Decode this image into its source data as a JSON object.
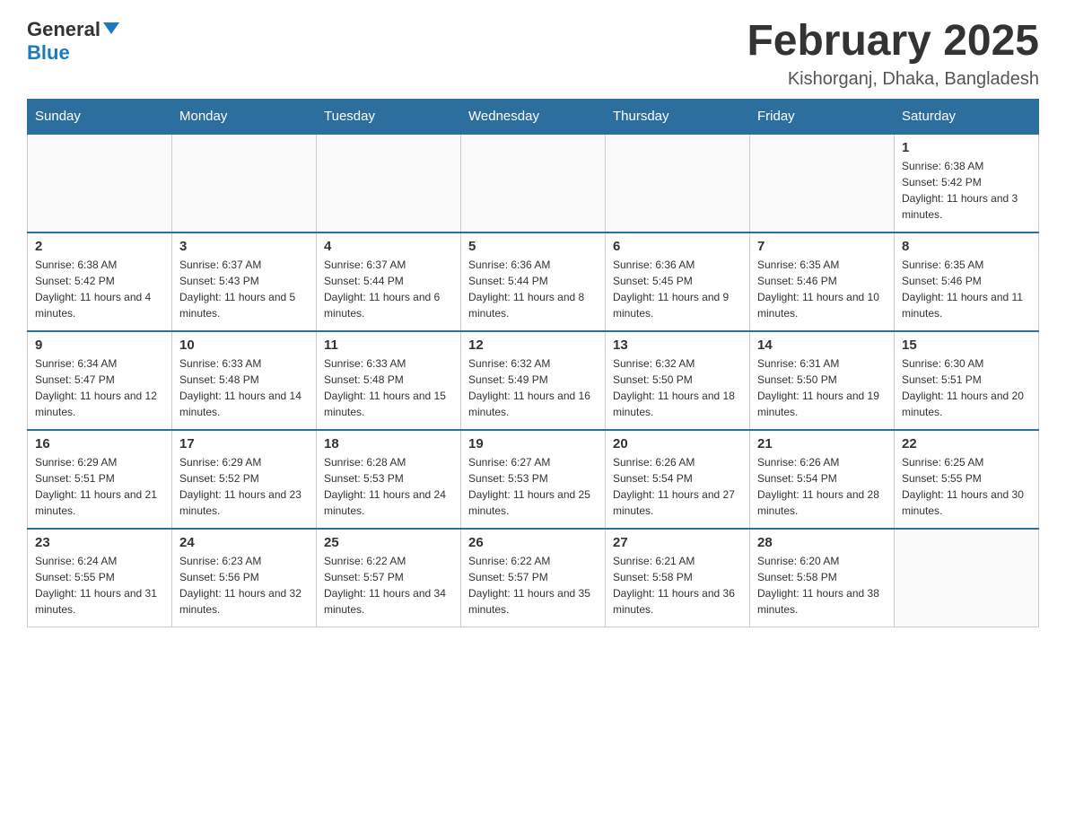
{
  "header": {
    "logo": {
      "general_text": "General",
      "blue_text": "Blue"
    },
    "title": "February 2025",
    "location": "Kishorganj, Dhaka, Bangladesh"
  },
  "days_of_week": [
    "Sunday",
    "Monday",
    "Tuesday",
    "Wednesday",
    "Thursday",
    "Friday",
    "Saturday"
  ],
  "weeks": [
    [
      {
        "day": "",
        "sunrise": "",
        "sunset": "",
        "daylight": ""
      },
      {
        "day": "",
        "sunrise": "",
        "sunset": "",
        "daylight": ""
      },
      {
        "day": "",
        "sunrise": "",
        "sunset": "",
        "daylight": ""
      },
      {
        "day": "",
        "sunrise": "",
        "sunset": "",
        "daylight": ""
      },
      {
        "day": "",
        "sunrise": "",
        "sunset": "",
        "daylight": ""
      },
      {
        "day": "",
        "sunrise": "",
        "sunset": "",
        "daylight": ""
      },
      {
        "day": "1",
        "sunrise": "Sunrise: 6:38 AM",
        "sunset": "Sunset: 5:42 PM",
        "daylight": "Daylight: 11 hours and 3 minutes."
      }
    ],
    [
      {
        "day": "2",
        "sunrise": "Sunrise: 6:38 AM",
        "sunset": "Sunset: 5:42 PM",
        "daylight": "Daylight: 11 hours and 4 minutes."
      },
      {
        "day": "3",
        "sunrise": "Sunrise: 6:37 AM",
        "sunset": "Sunset: 5:43 PM",
        "daylight": "Daylight: 11 hours and 5 minutes."
      },
      {
        "day": "4",
        "sunrise": "Sunrise: 6:37 AM",
        "sunset": "Sunset: 5:44 PM",
        "daylight": "Daylight: 11 hours and 6 minutes."
      },
      {
        "day": "5",
        "sunrise": "Sunrise: 6:36 AM",
        "sunset": "Sunset: 5:44 PM",
        "daylight": "Daylight: 11 hours and 8 minutes."
      },
      {
        "day": "6",
        "sunrise": "Sunrise: 6:36 AM",
        "sunset": "Sunset: 5:45 PM",
        "daylight": "Daylight: 11 hours and 9 minutes."
      },
      {
        "day": "7",
        "sunrise": "Sunrise: 6:35 AM",
        "sunset": "Sunset: 5:46 PM",
        "daylight": "Daylight: 11 hours and 10 minutes."
      },
      {
        "day": "8",
        "sunrise": "Sunrise: 6:35 AM",
        "sunset": "Sunset: 5:46 PM",
        "daylight": "Daylight: 11 hours and 11 minutes."
      }
    ],
    [
      {
        "day": "9",
        "sunrise": "Sunrise: 6:34 AM",
        "sunset": "Sunset: 5:47 PM",
        "daylight": "Daylight: 11 hours and 12 minutes."
      },
      {
        "day": "10",
        "sunrise": "Sunrise: 6:33 AM",
        "sunset": "Sunset: 5:48 PM",
        "daylight": "Daylight: 11 hours and 14 minutes."
      },
      {
        "day": "11",
        "sunrise": "Sunrise: 6:33 AM",
        "sunset": "Sunset: 5:48 PM",
        "daylight": "Daylight: 11 hours and 15 minutes."
      },
      {
        "day": "12",
        "sunrise": "Sunrise: 6:32 AM",
        "sunset": "Sunset: 5:49 PM",
        "daylight": "Daylight: 11 hours and 16 minutes."
      },
      {
        "day": "13",
        "sunrise": "Sunrise: 6:32 AM",
        "sunset": "Sunset: 5:50 PM",
        "daylight": "Daylight: 11 hours and 18 minutes."
      },
      {
        "day": "14",
        "sunrise": "Sunrise: 6:31 AM",
        "sunset": "Sunset: 5:50 PM",
        "daylight": "Daylight: 11 hours and 19 minutes."
      },
      {
        "day": "15",
        "sunrise": "Sunrise: 6:30 AM",
        "sunset": "Sunset: 5:51 PM",
        "daylight": "Daylight: 11 hours and 20 minutes."
      }
    ],
    [
      {
        "day": "16",
        "sunrise": "Sunrise: 6:29 AM",
        "sunset": "Sunset: 5:51 PM",
        "daylight": "Daylight: 11 hours and 21 minutes."
      },
      {
        "day": "17",
        "sunrise": "Sunrise: 6:29 AM",
        "sunset": "Sunset: 5:52 PM",
        "daylight": "Daylight: 11 hours and 23 minutes."
      },
      {
        "day": "18",
        "sunrise": "Sunrise: 6:28 AM",
        "sunset": "Sunset: 5:53 PM",
        "daylight": "Daylight: 11 hours and 24 minutes."
      },
      {
        "day": "19",
        "sunrise": "Sunrise: 6:27 AM",
        "sunset": "Sunset: 5:53 PM",
        "daylight": "Daylight: 11 hours and 25 minutes."
      },
      {
        "day": "20",
        "sunrise": "Sunrise: 6:26 AM",
        "sunset": "Sunset: 5:54 PM",
        "daylight": "Daylight: 11 hours and 27 minutes."
      },
      {
        "day": "21",
        "sunrise": "Sunrise: 6:26 AM",
        "sunset": "Sunset: 5:54 PM",
        "daylight": "Daylight: 11 hours and 28 minutes."
      },
      {
        "day": "22",
        "sunrise": "Sunrise: 6:25 AM",
        "sunset": "Sunset: 5:55 PM",
        "daylight": "Daylight: 11 hours and 30 minutes."
      }
    ],
    [
      {
        "day": "23",
        "sunrise": "Sunrise: 6:24 AM",
        "sunset": "Sunset: 5:55 PM",
        "daylight": "Daylight: 11 hours and 31 minutes."
      },
      {
        "day": "24",
        "sunrise": "Sunrise: 6:23 AM",
        "sunset": "Sunset: 5:56 PM",
        "daylight": "Daylight: 11 hours and 32 minutes."
      },
      {
        "day": "25",
        "sunrise": "Sunrise: 6:22 AM",
        "sunset": "Sunset: 5:57 PM",
        "daylight": "Daylight: 11 hours and 34 minutes."
      },
      {
        "day": "26",
        "sunrise": "Sunrise: 6:22 AM",
        "sunset": "Sunset: 5:57 PM",
        "daylight": "Daylight: 11 hours and 35 minutes."
      },
      {
        "day": "27",
        "sunrise": "Sunrise: 6:21 AM",
        "sunset": "Sunset: 5:58 PM",
        "daylight": "Daylight: 11 hours and 36 minutes."
      },
      {
        "day": "28",
        "sunrise": "Sunrise: 6:20 AM",
        "sunset": "Sunset: 5:58 PM",
        "daylight": "Daylight: 11 hours and 38 minutes."
      },
      {
        "day": "",
        "sunrise": "",
        "sunset": "",
        "daylight": ""
      }
    ]
  ]
}
